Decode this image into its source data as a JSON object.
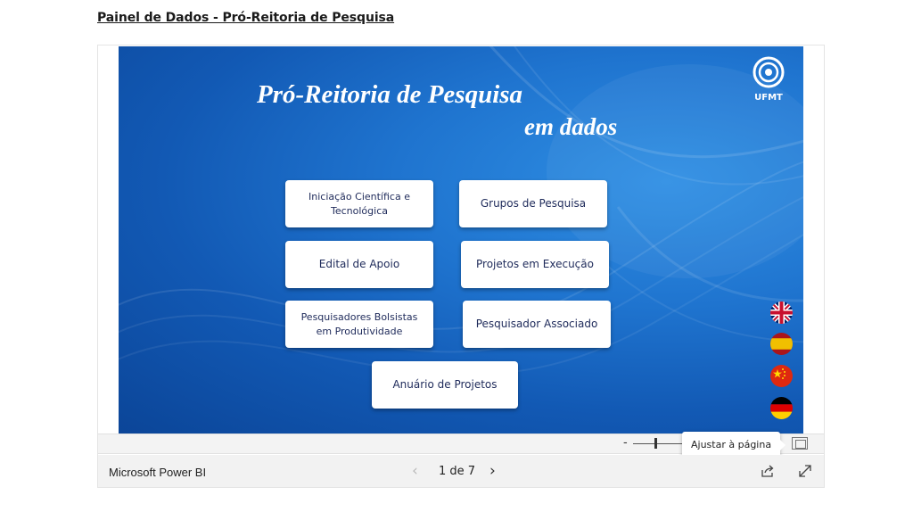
{
  "page": {
    "title": "Painel de Dados - Pró-Reitoria de Pesquisa"
  },
  "report": {
    "hero_line1": "Pró-Reitoria de Pesquisa",
    "hero_line2": "em dados",
    "logo_text": "UFMT",
    "buttons": [
      {
        "label": "Iniciação Científica e Tecnológica"
      },
      {
        "label": "Grupos de Pesquisa"
      },
      {
        "label": "Edital de Apoio"
      },
      {
        "label": "Projetos em Execução"
      },
      {
        "label": "Pesquisadores Bolsistas em Produtividade"
      },
      {
        "label": "Pesquisador Associado"
      },
      {
        "label": "Anuário de Projetos"
      }
    ],
    "languages": [
      {
        "icon": "uk-flag-icon"
      },
      {
        "icon": "spain-flag-icon"
      },
      {
        "icon": "china-flag-icon"
      },
      {
        "icon": "germany-flag-icon"
      }
    ],
    "background_color": "#1a6cc8"
  },
  "toolbar": {
    "zoom_minus": "-",
    "tooltip": "Ajustar à página"
  },
  "footer": {
    "brand": "Microsoft Power BI",
    "page_indicator": "1 de 7",
    "prev_icon": "chevron-left-icon",
    "next_icon": "chevron-right-icon",
    "share_icon": "share-icon",
    "expand_icon": "expand-icon"
  }
}
